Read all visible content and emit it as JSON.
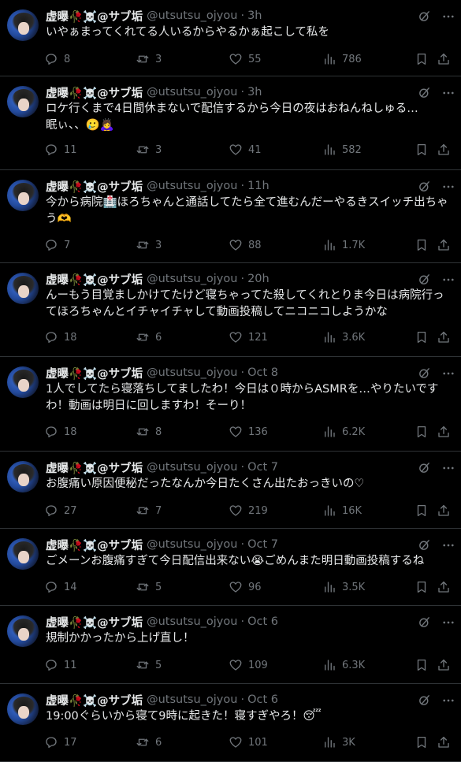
{
  "colors": {
    "background": "#000000",
    "text": "#e7e9ea",
    "muted": "#71767b",
    "divider": "#2f3336"
  },
  "icons": [
    "grok-icon",
    "more-icon",
    "reply-icon",
    "retweet-icon",
    "like-icon",
    "views-icon",
    "bookmark-icon",
    "share-icon"
  ],
  "tweets": [
    {
      "name": "虚曝🥀☠️@サブ垢",
      "handle": "@utsutsu_ojyou",
      "time": "3h",
      "text": "いやぁまってくれてる人いるからやるかぁ起こして私を",
      "replies": "8",
      "retweets": "3",
      "likes": "55",
      "views": "786"
    },
    {
      "name": "虚曝🥀☠️@サブ垢",
      "handle": "@utsutsu_ojyou",
      "time": "3h",
      "text": "ロケ行くまで4日間休まないで配信するから今日の夜はおねんねしゅる…\n眠ぃ、、🥲🙇‍♀️",
      "replies": "11",
      "retweets": "3",
      "likes": "41",
      "views": "582"
    },
    {
      "name": "虚曝🥀☠️@サブ垢",
      "handle": "@utsutsu_ojyou",
      "time": "11h",
      "text": "今から病院🏥ほろちゃんと通話してたら全て進むんだーやるきスイッチ出ちゃう🫶",
      "replies": "7",
      "retweets": "3",
      "likes": "88",
      "views": "1.7K"
    },
    {
      "name": "虚曝🥀☠️@サブ垢",
      "handle": "@utsutsu_ojyou",
      "time": "20h",
      "text": "んーもう目覚ましかけてたけど寝ちゃってた殺してくれとりま今日は病院行ってほろちゃんとイチャイチャして動画投稿してニコニコしようかな",
      "replies": "18",
      "retweets": "6",
      "likes": "121",
      "views": "3.6K"
    },
    {
      "name": "虚曝🥀☠️@サブ垢",
      "handle": "@utsutsu_ojyou",
      "time": "Oct 8",
      "text": "1人でしてたら寝落ちしてましたわ！今日は０時からASMRを…やりたいですわ！動画は明日に回しますわ！そーり！",
      "replies": "18",
      "retweets": "8",
      "likes": "136",
      "views": "6.2K"
    },
    {
      "name": "虚曝🥀☠️@サブ垢",
      "handle": "@utsutsu_ojyou",
      "time": "Oct 7",
      "text": "お腹痛い原因便秘だったなんか今日たくさん出たおっきいの♡",
      "replies": "27",
      "retweets": "7",
      "likes": "219",
      "views": "16K"
    },
    {
      "name": "虚曝🥀☠️@サブ垢",
      "handle": "@utsutsu_ojyou",
      "time": "Oct 7",
      "text": "ごメーンお腹痛すぎて今日配信出来ない😭ごめんまた明日動画投稿するね",
      "replies": "14",
      "retweets": "5",
      "likes": "96",
      "views": "3.5K"
    },
    {
      "name": "虚曝🥀☠️@サブ垢",
      "handle": "@utsutsu_ojyou",
      "time": "Oct 6",
      "text": "規制かかったから上げ直し！",
      "replies": "11",
      "retweets": "5",
      "likes": "109",
      "views": "6.3K"
    },
    {
      "name": "虚曝🥀☠️@サブ垢",
      "handle": "@utsutsu_ojyou",
      "time": "Oct 6",
      "text": "19:00ぐらいから寝て9時に起きた！寝すぎやろ！😴",
      "replies": "17",
      "retweets": "6",
      "likes": "101",
      "views": "3K"
    }
  ]
}
